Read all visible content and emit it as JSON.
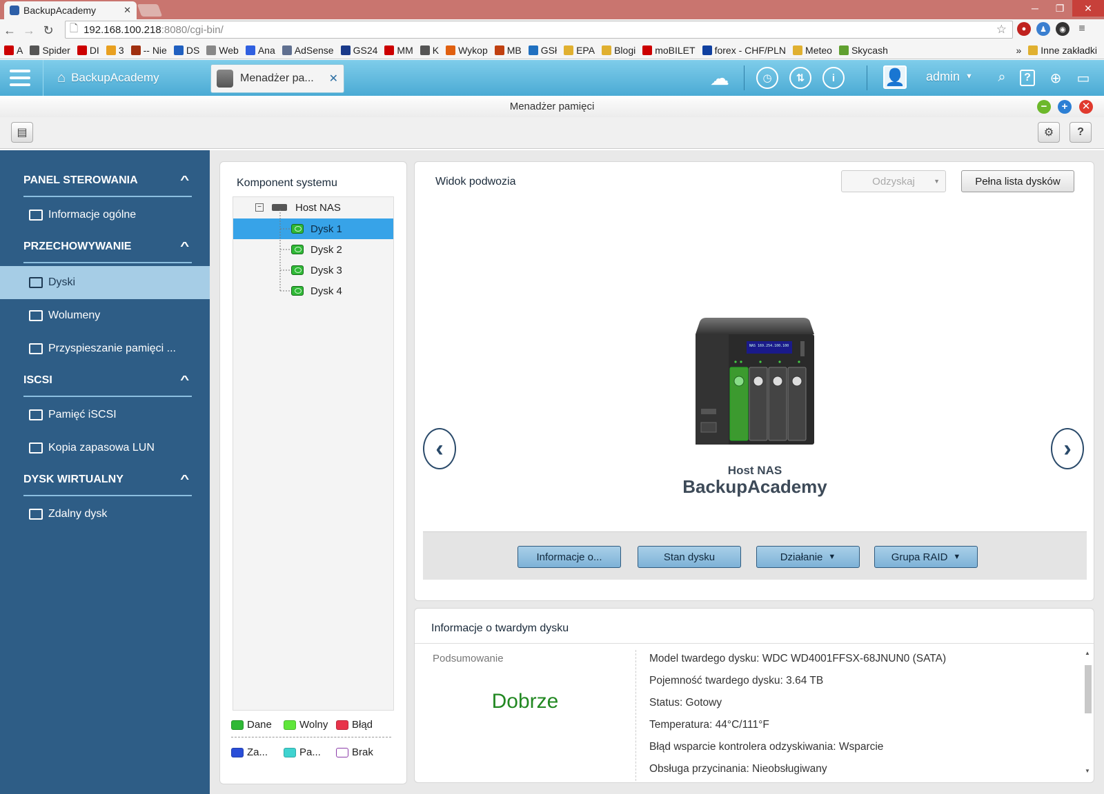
{
  "browser": {
    "tab_title": "BackupAcademy",
    "url_host": "192.168.100.218",
    "url_rest": ":8080/cgi-bin/",
    "bookmarks": [
      "A",
      "Spider",
      "DI",
      "3",
      "-- Nie",
      "DS",
      "Web",
      "Ana",
      "AdSense",
      "GS24",
      "MM",
      "K",
      "Wykop",
      "MB",
      "GSł",
      "EPA",
      "Blogi",
      "moBILET",
      "forex - CHF/PLN",
      "Meteo",
      "Skycash"
    ],
    "bookmarks_more": "»",
    "other_bookmarks": "Inne zakładki"
  },
  "app": {
    "home_label": "BackupAcademy",
    "open_tab": "Menadżer pa...",
    "user": "admin"
  },
  "window": {
    "title": "Menadżer pamięci"
  },
  "sidebar": {
    "sections": [
      {
        "title": "PANEL STEROWANIA",
        "items": [
          "Informacje ogólne"
        ]
      },
      {
        "title": "PRZECHOWYWANIE",
        "items": [
          "Dyski",
          "Wolumeny",
          "Przyspieszanie pamięci ..."
        ]
      },
      {
        "title": "ISCSI",
        "items": [
          "Pamięć iSCSI",
          "Kopia zapasowa LUN"
        ]
      },
      {
        "title": "DYSK WIRTUALNY",
        "items": [
          "Zdalny dysk"
        ]
      }
    ],
    "selected": "Dyski"
  },
  "component": {
    "title": "Komponent systemu",
    "root": "Host NAS",
    "disks": [
      "Dysk 1",
      "Dysk 2",
      "Dysk 3",
      "Dysk 4"
    ],
    "selected": "Dysk 1",
    "legend": [
      {
        "label": "Dane",
        "color": "#2fb836"
      },
      {
        "label": "Wolny",
        "color": "#5fe63a"
      },
      {
        "label": "Błąd",
        "color": "#e8334a"
      },
      {
        "label": "Za...",
        "color": "#2a4ed8"
      },
      {
        "label": "Pa...",
        "color": "#3fd3d0"
      },
      {
        "label": "Brak",
        "color": "#ffffff"
      }
    ]
  },
  "chassis": {
    "title": "Widok podwozia",
    "recover_select": "Odzyskaj",
    "full_list_button": "Pełna lista dysków",
    "host_label": "Host NAS",
    "host_name": "BackupAcademy",
    "lcd_text": "NAS 169.254.100.100",
    "actions": [
      "Informacje o...",
      "Stan dysku",
      "Działanie",
      "Grupa RAID"
    ]
  },
  "hdd_info": {
    "title": "Informacje o twardym dysku",
    "summary_label": "Podsumowanie",
    "summary_status": "Dobrze",
    "status_color": "#228822",
    "lines": [
      "Model twardego dysku: WDC WD4001FFSX-68JNUN0 (SATA)",
      "Pojemność twardego dysku: 3.64 TB",
      "Status: Gotowy",
      "Temperatura: 44°C/111°F",
      "Błąd wsparcie kontrolera odzyskiwania: Wsparcie",
      "Obsługa przycinania: Nieobsługiwany"
    ]
  }
}
